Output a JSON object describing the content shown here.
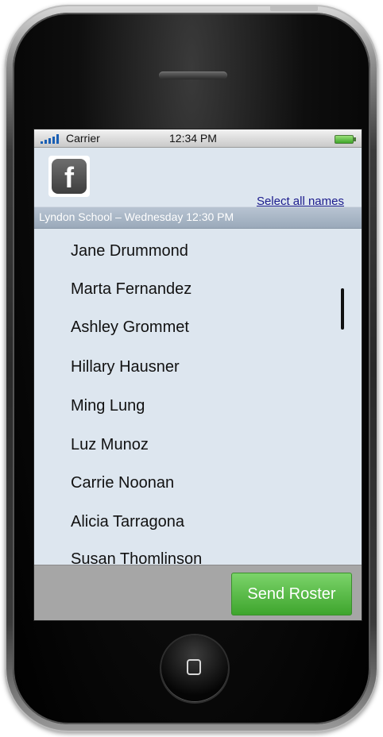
{
  "status_bar": {
    "carrier": "Carrier",
    "time": "12:34 PM",
    "signal_icon": "signal-bars-icon",
    "battery_icon": "battery-icon"
  },
  "header": {
    "logo_icon": "facebook-icon",
    "logo_glyph": "f",
    "select_all_label": "Select all names"
  },
  "section": {
    "title": "Lyndon School – Wednesday 12:30 PM"
  },
  "roster": {
    "names": [
      "Jane Drummond",
      "Marta Fernandez",
      "Ashley Grommet",
      "Hillary Hausner",
      "Ming Lung",
      "Luz Munoz",
      "Carrie Noonan",
      "Alicia Tarragona",
      "Susan Thomlinson"
    ]
  },
  "footer": {
    "send_label": "Send Roster"
  },
  "colors": {
    "screen_bg": "#dde6ef",
    "section_bar": "#a9b6c6",
    "send_button": "#4fb83c",
    "link": "#1a1a8c"
  }
}
